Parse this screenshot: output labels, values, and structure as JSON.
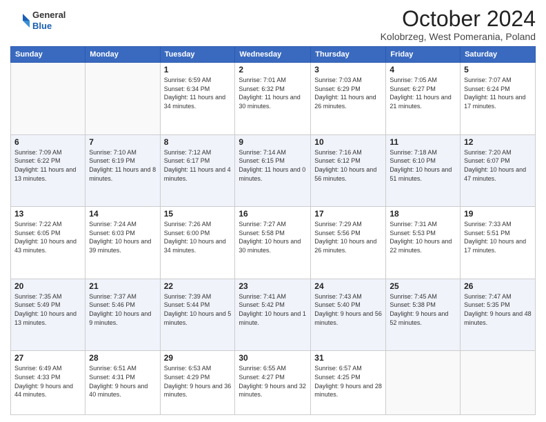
{
  "logo": {
    "general": "General",
    "blue": "Blue"
  },
  "header": {
    "title": "October 2024",
    "subtitle": "Kolobrzeg, West Pomerania, Poland"
  },
  "weekdays": [
    "Sunday",
    "Monday",
    "Tuesday",
    "Wednesday",
    "Thursday",
    "Friday",
    "Saturday"
  ],
  "weeks": [
    [
      {
        "day": "",
        "info": ""
      },
      {
        "day": "",
        "info": ""
      },
      {
        "day": "1",
        "info": "Sunrise: 6:59 AM\nSunset: 6:34 PM\nDaylight: 11 hours\nand 34 minutes."
      },
      {
        "day": "2",
        "info": "Sunrise: 7:01 AM\nSunset: 6:32 PM\nDaylight: 11 hours\nand 30 minutes."
      },
      {
        "day": "3",
        "info": "Sunrise: 7:03 AM\nSunset: 6:29 PM\nDaylight: 11 hours\nand 26 minutes."
      },
      {
        "day": "4",
        "info": "Sunrise: 7:05 AM\nSunset: 6:27 PM\nDaylight: 11 hours\nand 21 minutes."
      },
      {
        "day": "5",
        "info": "Sunrise: 7:07 AM\nSunset: 6:24 PM\nDaylight: 11 hours\nand 17 minutes."
      }
    ],
    [
      {
        "day": "6",
        "info": "Sunrise: 7:09 AM\nSunset: 6:22 PM\nDaylight: 11 hours\nand 13 minutes."
      },
      {
        "day": "7",
        "info": "Sunrise: 7:10 AM\nSunset: 6:19 PM\nDaylight: 11 hours\nand 8 minutes."
      },
      {
        "day": "8",
        "info": "Sunrise: 7:12 AM\nSunset: 6:17 PM\nDaylight: 11 hours\nand 4 minutes."
      },
      {
        "day": "9",
        "info": "Sunrise: 7:14 AM\nSunset: 6:15 PM\nDaylight: 11 hours\nand 0 minutes."
      },
      {
        "day": "10",
        "info": "Sunrise: 7:16 AM\nSunset: 6:12 PM\nDaylight: 10 hours\nand 56 minutes."
      },
      {
        "day": "11",
        "info": "Sunrise: 7:18 AM\nSunset: 6:10 PM\nDaylight: 10 hours\nand 51 minutes."
      },
      {
        "day": "12",
        "info": "Sunrise: 7:20 AM\nSunset: 6:07 PM\nDaylight: 10 hours\nand 47 minutes."
      }
    ],
    [
      {
        "day": "13",
        "info": "Sunrise: 7:22 AM\nSunset: 6:05 PM\nDaylight: 10 hours\nand 43 minutes."
      },
      {
        "day": "14",
        "info": "Sunrise: 7:24 AM\nSunset: 6:03 PM\nDaylight: 10 hours\nand 39 minutes."
      },
      {
        "day": "15",
        "info": "Sunrise: 7:26 AM\nSunset: 6:00 PM\nDaylight: 10 hours\nand 34 minutes."
      },
      {
        "day": "16",
        "info": "Sunrise: 7:27 AM\nSunset: 5:58 PM\nDaylight: 10 hours\nand 30 minutes."
      },
      {
        "day": "17",
        "info": "Sunrise: 7:29 AM\nSunset: 5:56 PM\nDaylight: 10 hours\nand 26 minutes."
      },
      {
        "day": "18",
        "info": "Sunrise: 7:31 AM\nSunset: 5:53 PM\nDaylight: 10 hours\nand 22 minutes."
      },
      {
        "day": "19",
        "info": "Sunrise: 7:33 AM\nSunset: 5:51 PM\nDaylight: 10 hours\nand 17 minutes."
      }
    ],
    [
      {
        "day": "20",
        "info": "Sunrise: 7:35 AM\nSunset: 5:49 PM\nDaylight: 10 hours\nand 13 minutes."
      },
      {
        "day": "21",
        "info": "Sunrise: 7:37 AM\nSunset: 5:46 PM\nDaylight: 10 hours\nand 9 minutes."
      },
      {
        "day": "22",
        "info": "Sunrise: 7:39 AM\nSunset: 5:44 PM\nDaylight: 10 hours\nand 5 minutes."
      },
      {
        "day": "23",
        "info": "Sunrise: 7:41 AM\nSunset: 5:42 PM\nDaylight: 10 hours\nand 1 minute."
      },
      {
        "day": "24",
        "info": "Sunrise: 7:43 AM\nSunset: 5:40 PM\nDaylight: 9 hours\nand 56 minutes."
      },
      {
        "day": "25",
        "info": "Sunrise: 7:45 AM\nSunset: 5:38 PM\nDaylight: 9 hours\nand 52 minutes."
      },
      {
        "day": "26",
        "info": "Sunrise: 7:47 AM\nSunset: 5:35 PM\nDaylight: 9 hours\nand 48 minutes."
      }
    ],
    [
      {
        "day": "27",
        "info": "Sunrise: 6:49 AM\nSunset: 4:33 PM\nDaylight: 9 hours\nand 44 minutes."
      },
      {
        "day": "28",
        "info": "Sunrise: 6:51 AM\nSunset: 4:31 PM\nDaylight: 9 hours\nand 40 minutes."
      },
      {
        "day": "29",
        "info": "Sunrise: 6:53 AM\nSunset: 4:29 PM\nDaylight: 9 hours\nand 36 minutes."
      },
      {
        "day": "30",
        "info": "Sunrise: 6:55 AM\nSunset: 4:27 PM\nDaylight: 9 hours\nand 32 minutes."
      },
      {
        "day": "31",
        "info": "Sunrise: 6:57 AM\nSunset: 4:25 PM\nDaylight: 9 hours\nand 28 minutes."
      },
      {
        "day": "",
        "info": ""
      },
      {
        "day": "",
        "info": ""
      }
    ]
  ]
}
